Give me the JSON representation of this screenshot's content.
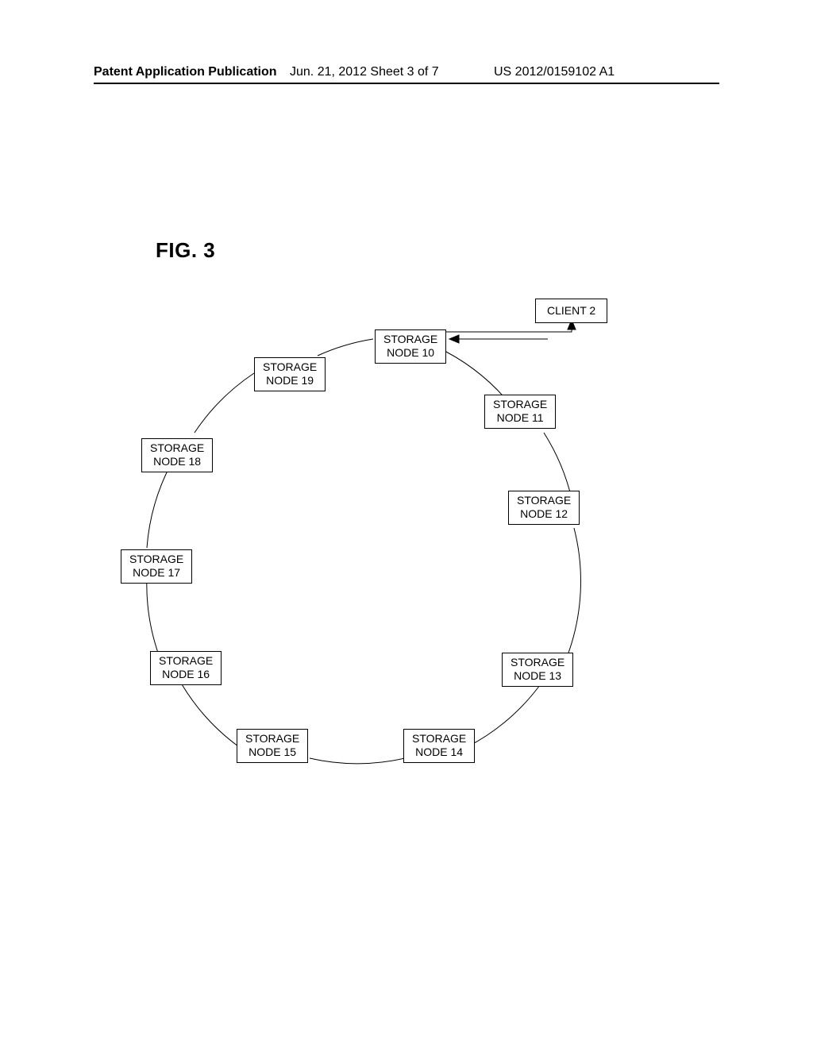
{
  "header": {
    "left": "Patent Application Publication",
    "center": "Jun. 21, 2012  Sheet 3 of 7",
    "right": "US 2012/0159102 A1"
  },
  "figure": {
    "title": "FIG. 3"
  },
  "client": {
    "label": "CLIENT 2"
  },
  "nodes": {
    "n10": {
      "line1": "STORAGE",
      "line2": "NODE 10"
    },
    "n11": {
      "line1": "STORAGE",
      "line2": "NODE 11"
    },
    "n12": {
      "line1": "STORAGE",
      "line2": "NODE 12"
    },
    "n13": {
      "line1": "STORAGE",
      "line2": "NODE 13"
    },
    "n14": {
      "line1": "STORAGE",
      "line2": "NODE 14"
    },
    "n15": {
      "line1": "STORAGE",
      "line2": "NODE 15"
    },
    "n16": {
      "line1": "STORAGE",
      "line2": "NODE 16"
    },
    "n17": {
      "line1": "STORAGE",
      "line2": "NODE 17"
    },
    "n18": {
      "line1": "STORAGE",
      "line2": "NODE 18"
    },
    "n19": {
      "line1": "STORAGE",
      "line2": "NODE 19"
    }
  }
}
